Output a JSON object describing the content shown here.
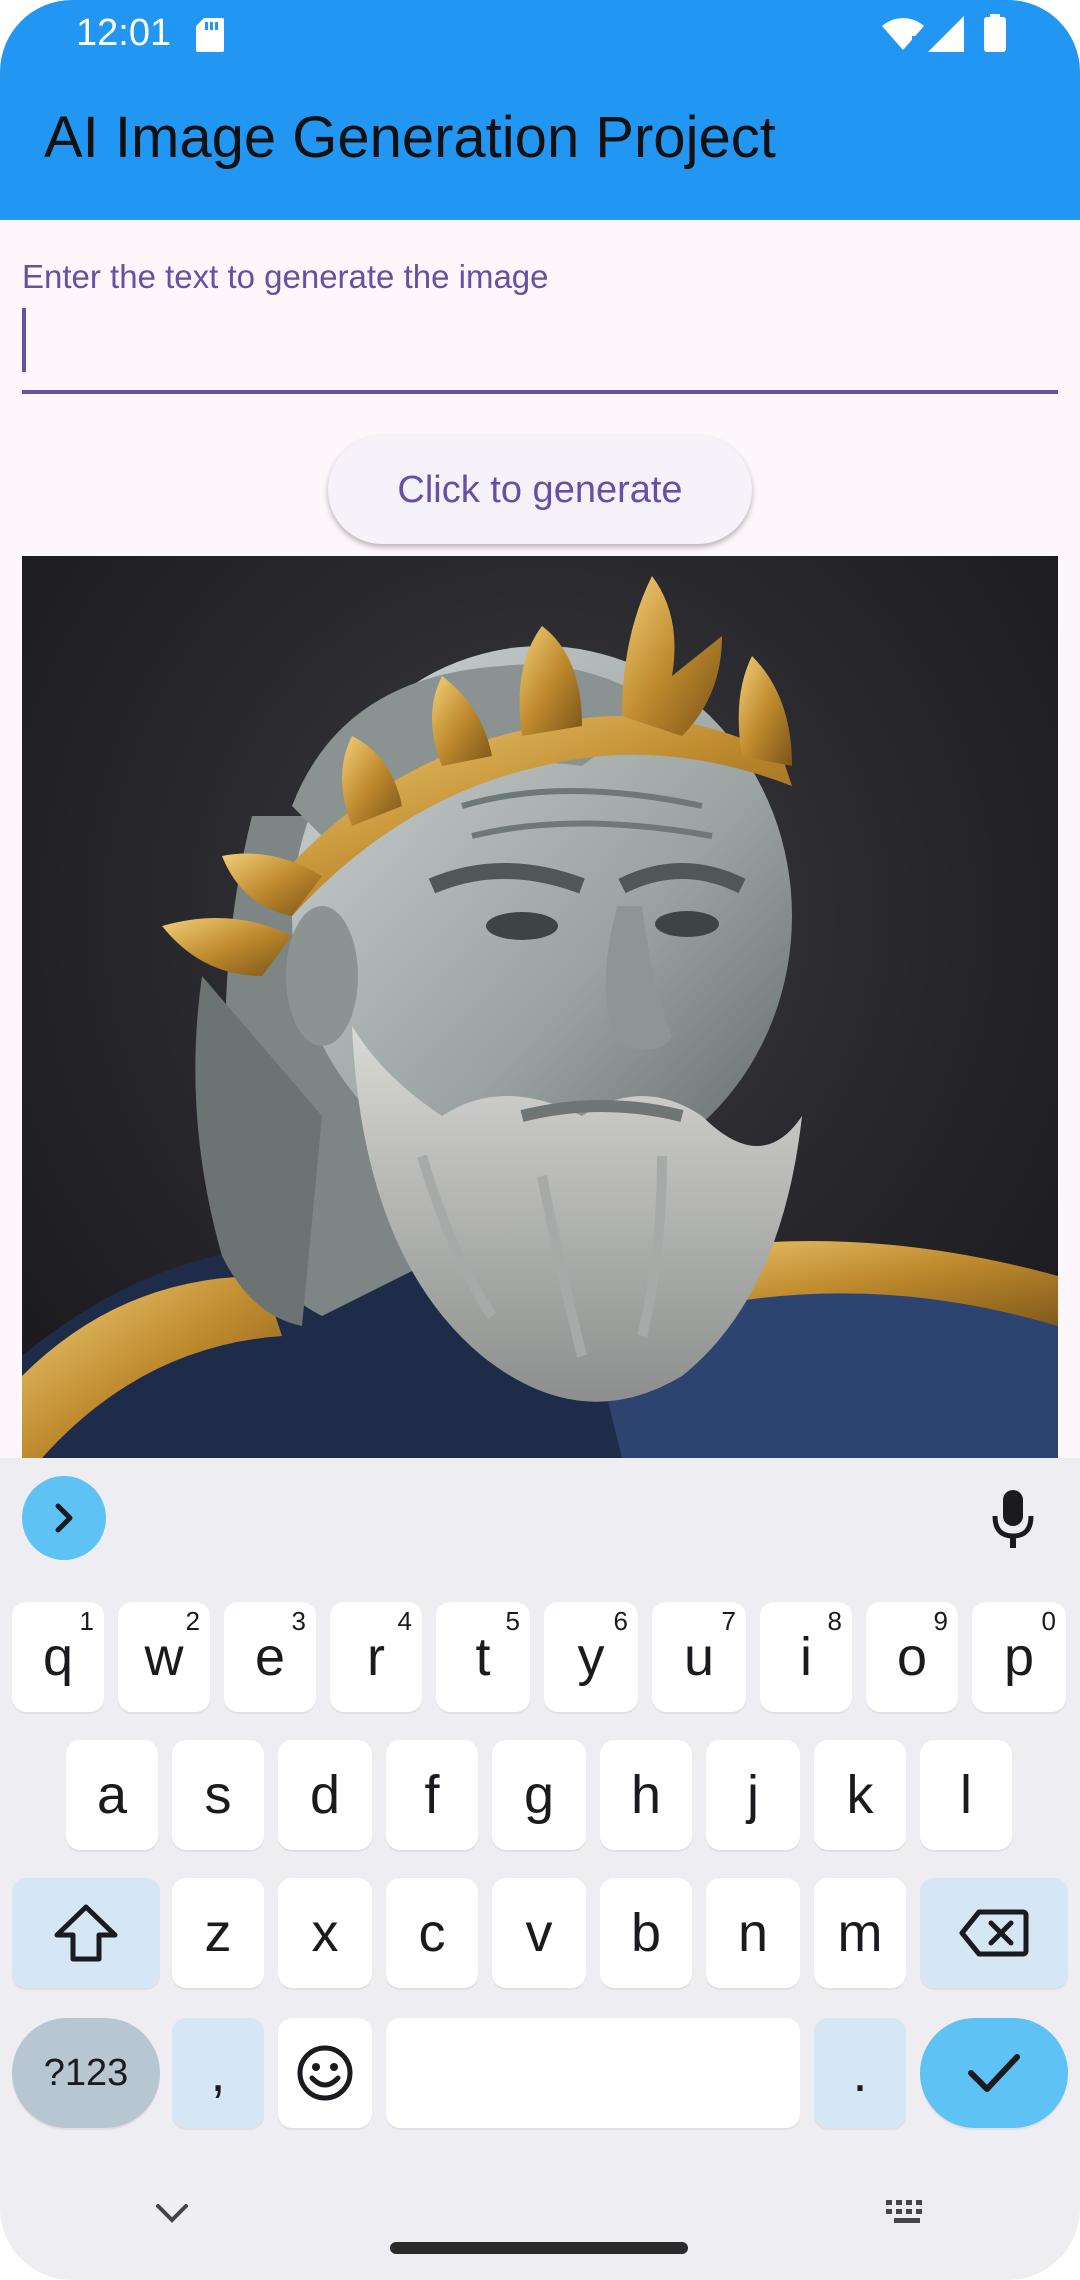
{
  "status": {
    "time": "12:01",
    "icons": [
      "sd-card-icon",
      "wifi-icon",
      "signal-icon",
      "battery-icon"
    ]
  },
  "app": {
    "title": "AI Image Generation Project",
    "bar_color": "#2196f3"
  },
  "prompt_field": {
    "label": "Enter the text to generate the image",
    "value": "",
    "accent_color": "#6750a4"
  },
  "generate_button": {
    "label": "Click to generate"
  },
  "generated_image": {
    "description_icon": "generated-image"
  },
  "keyboard": {
    "row1": [
      {
        "key": "q",
        "hint": "1"
      },
      {
        "key": "w",
        "hint": "2"
      },
      {
        "key": "e",
        "hint": "3"
      },
      {
        "key": "r",
        "hint": "4"
      },
      {
        "key": "t",
        "hint": "5"
      },
      {
        "key": "y",
        "hint": "6"
      },
      {
        "key": "u",
        "hint": "7"
      },
      {
        "key": "i",
        "hint": "8"
      },
      {
        "key": "o",
        "hint": "9"
      },
      {
        "key": "p",
        "hint": "0"
      }
    ],
    "row2": [
      "a",
      "s",
      "d",
      "f",
      "g",
      "h",
      "j",
      "k",
      "l"
    ],
    "row3": [
      "z",
      "x",
      "c",
      "v",
      "b",
      "n",
      "m"
    ],
    "symbols_key": "?123",
    "comma_key": ",",
    "period_key": ".",
    "accent_color": "#5ec2f5"
  }
}
